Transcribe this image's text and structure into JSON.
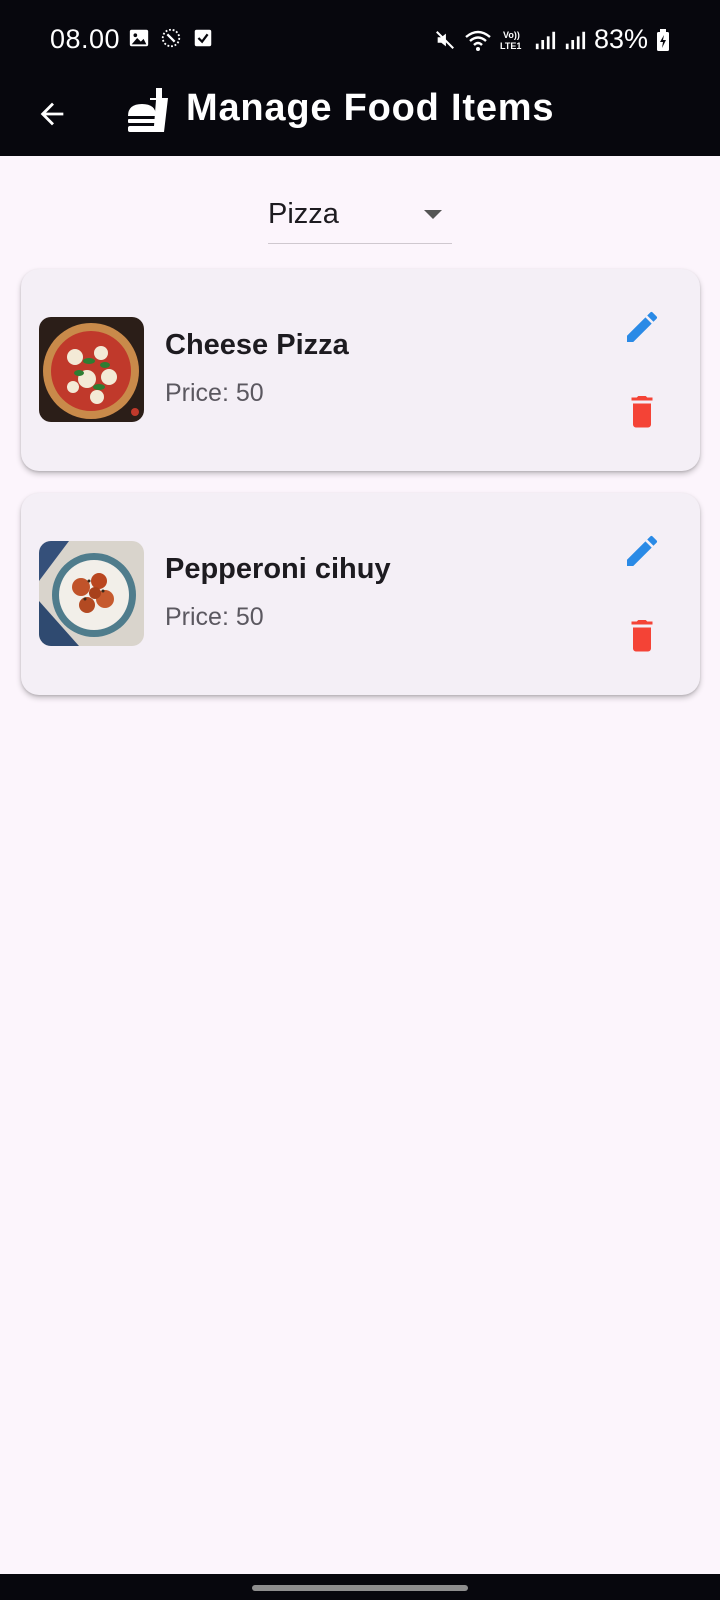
{
  "status_bar": {
    "time": "08.00",
    "battery": "83%",
    "icons": [
      "gallery-icon",
      "snooze-icon",
      "checkbox-icon",
      "mute-icon",
      "wifi-icon",
      "volte-icon",
      "signal-icon",
      "signal-icon-2",
      "battery-charging-icon"
    ]
  },
  "app_bar": {
    "title": "Manage Food Items",
    "back_icon": "arrow-back-icon",
    "title_icon": "fastfood-icon"
  },
  "category_dropdown": {
    "selected": "Pizza"
  },
  "items": [
    {
      "name": "Cheese Pizza",
      "price": "Price: 50",
      "image": "pizza-photo"
    },
    {
      "name": "Pepperoni cihuy",
      "price": "Price: 50",
      "image": "rice-bowl-photo"
    }
  ],
  "colors": {
    "app_bar_bg": "#07070d",
    "background": "#fcf5fc",
    "card_bg": "#f4eff6",
    "edit": "#2a8ae6",
    "delete": "#f44336"
  }
}
